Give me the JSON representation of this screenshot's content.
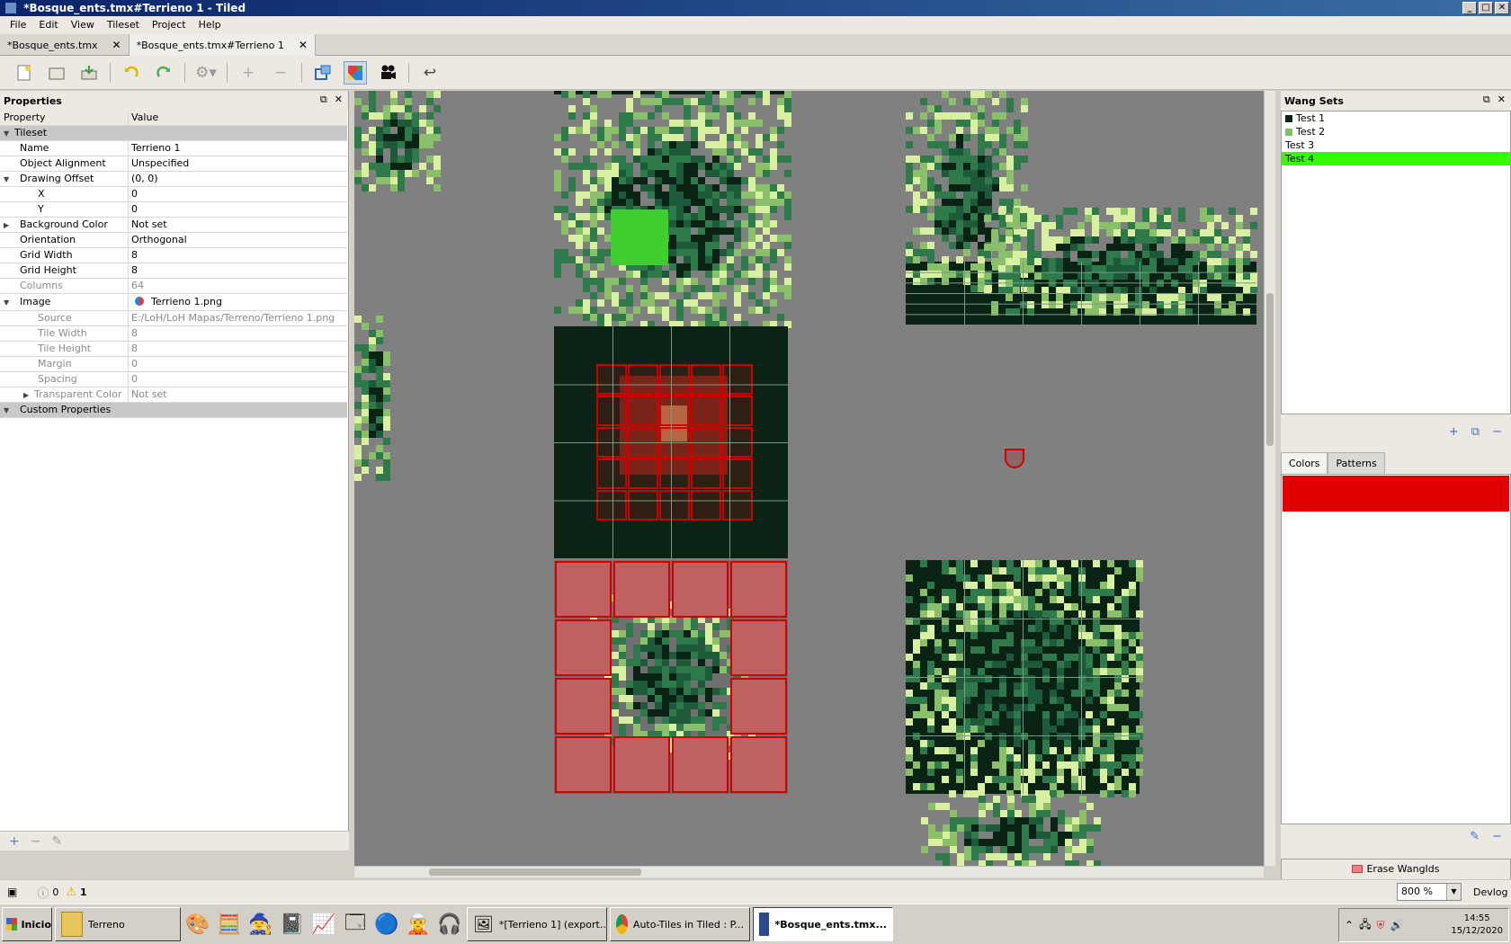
{
  "window": {
    "title": "*Bosque_ents.tmx#Terrieno 1 - Tiled"
  },
  "menu": [
    "File",
    "Edit",
    "View",
    "Tileset",
    "Project",
    "Help"
  ],
  "tabs": [
    {
      "label": "*Bosque_ents.tmx",
      "active": false
    },
    {
      "label": "*Bosque_ents.tmx#Terrieno 1",
      "active": true
    }
  ],
  "toolbar_icons": [
    "new-file-icon",
    "open-icon",
    "save-icon",
    "undo-icon",
    "redo-icon",
    "settings-icon",
    "add-icon",
    "remove-icon",
    "tile-collision-icon",
    "terrain-icon",
    "animation-icon",
    "return-icon"
  ],
  "properties": {
    "title": "Properties",
    "col_property": "Property",
    "col_value": "Value",
    "group_tileset": "Tileset",
    "rows": [
      {
        "key": "Name",
        "value": "Terrieno 1"
      },
      {
        "key": "Object Alignment",
        "value": "Unspecified"
      },
      {
        "key": "Drawing Offset",
        "value": "(0, 0)"
      },
      {
        "key": "X",
        "value": "0"
      },
      {
        "key": "Y",
        "value": "0"
      },
      {
        "key": "Background Color",
        "value": "Not set"
      },
      {
        "key": "Orientation",
        "value": "Orthogonal"
      },
      {
        "key": "Grid Width",
        "value": "8"
      },
      {
        "key": "Grid Height",
        "value": "8"
      },
      {
        "key": "Columns",
        "value": "64"
      },
      {
        "key": "Image",
        "value": "Terrieno 1.png"
      },
      {
        "key": "Source",
        "value": "E:/LoH/LoH Mapas/Terreno/Terrieno 1.png"
      },
      {
        "key": "Tile Width",
        "value": "8"
      },
      {
        "key": "Tile Height",
        "value": "8"
      },
      {
        "key": "Margin",
        "value": "0"
      },
      {
        "key": "Spacing",
        "value": "0"
      },
      {
        "key": "Transparent Color",
        "value": "Not set"
      }
    ],
    "group_custom": "Custom Properties"
  },
  "wang": {
    "title": "Wang Sets",
    "items": [
      "Test 1",
      "Test 2",
      "Test 3",
      "Test 4"
    ],
    "selected": "Test 4"
  },
  "colors": {
    "tab_colors": "Colors",
    "tab_patterns": "Patterns",
    "swatch_color": "#e00000"
  },
  "erase_label": "Erase WangIds",
  "status": {
    "errors": "0",
    "warnings": "1",
    "zoom": "800 %",
    "devlog": "Devlog"
  },
  "taskbar": {
    "start": "Inicio",
    "tasks": [
      "Terreno",
      "*[Terrieno 1] (export...",
      "Auto-Tiles in Tiled : P...",
      "*Bosque_ents.tmx..."
    ],
    "time": "14:55",
    "date": "15/12/2020"
  },
  "palette": {
    "dark": "#0a2314",
    "mid": "#1c5a3a",
    "green": "#2e7a4a",
    "light": "#8bc06a",
    "pale": "#d9f0a0",
    "red": "#d00000",
    "red_fill": "#c06060"
  }
}
